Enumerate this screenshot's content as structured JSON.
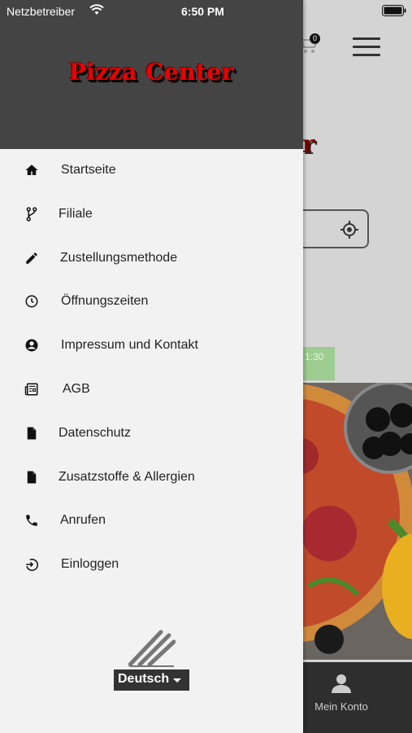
{
  "status_bar": {
    "carrier": "Netzbetreiber",
    "time": "6:50 PM"
  },
  "brand": {
    "name": "Pizza Center"
  },
  "menu": {
    "items": [
      {
        "label": "Startseite",
        "icon": "home-icon"
      },
      {
        "label": "Filiale",
        "icon": "branch-icon"
      },
      {
        "label": "Zustellungsmethode",
        "icon": "pencil-icon"
      },
      {
        "label": "Öffnungszeiten",
        "icon": "clock-icon"
      },
      {
        "label": "Impressum und Kontakt",
        "icon": "account-circle-icon"
      },
      {
        "label": "AGB",
        "icon": "newspaper-icon"
      },
      {
        "label": "Datenschutz",
        "icon": "file-icon"
      },
      {
        "label": "Zusatzstoffe & Allergien",
        "icon": "file-icon"
      },
      {
        "label": "Anrufen",
        "icon": "phone-icon"
      },
      {
        "label": "Einloggen",
        "icon": "login-icon"
      }
    ]
  },
  "language": {
    "selected": "Deutsch"
  },
  "background_app": {
    "cart_count": "0",
    "opening_hint": "1:30",
    "account_label": "Mein Konto"
  },
  "colors": {
    "drawer_header": "#444444",
    "drawer_bg": "#f2f2f2",
    "brand_red": "#ee0000",
    "bottom_bar": "#2e2e2e"
  }
}
